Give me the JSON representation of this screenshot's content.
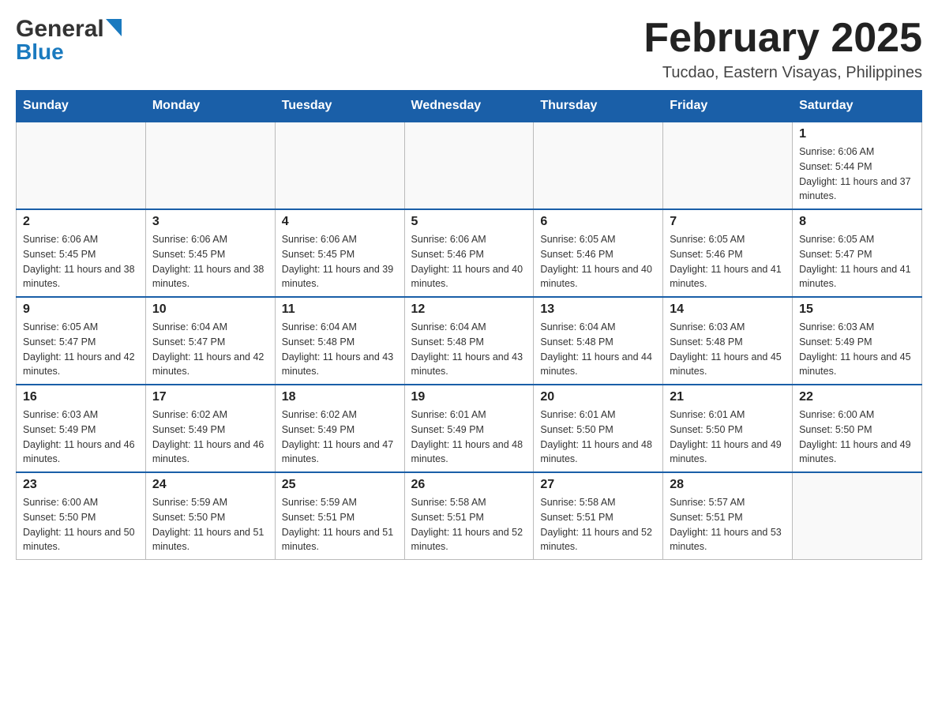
{
  "header": {
    "logo_general": "General",
    "logo_blue": "Blue",
    "month_title": "February 2025",
    "location": "Tucdao, Eastern Visayas, Philippines"
  },
  "weekdays": [
    "Sunday",
    "Monday",
    "Tuesday",
    "Wednesday",
    "Thursday",
    "Friday",
    "Saturday"
  ],
  "weeks": [
    [
      {
        "day": "",
        "sunrise": "",
        "sunset": "",
        "daylight": ""
      },
      {
        "day": "",
        "sunrise": "",
        "sunset": "",
        "daylight": ""
      },
      {
        "day": "",
        "sunrise": "",
        "sunset": "",
        "daylight": ""
      },
      {
        "day": "",
        "sunrise": "",
        "sunset": "",
        "daylight": ""
      },
      {
        "day": "",
        "sunrise": "",
        "sunset": "",
        "daylight": ""
      },
      {
        "day": "",
        "sunrise": "",
        "sunset": "",
        "daylight": ""
      },
      {
        "day": "1",
        "sunrise": "Sunrise: 6:06 AM",
        "sunset": "Sunset: 5:44 PM",
        "daylight": "Daylight: 11 hours and 37 minutes."
      }
    ],
    [
      {
        "day": "2",
        "sunrise": "Sunrise: 6:06 AM",
        "sunset": "Sunset: 5:45 PM",
        "daylight": "Daylight: 11 hours and 38 minutes."
      },
      {
        "day": "3",
        "sunrise": "Sunrise: 6:06 AM",
        "sunset": "Sunset: 5:45 PM",
        "daylight": "Daylight: 11 hours and 38 minutes."
      },
      {
        "day": "4",
        "sunrise": "Sunrise: 6:06 AM",
        "sunset": "Sunset: 5:45 PM",
        "daylight": "Daylight: 11 hours and 39 minutes."
      },
      {
        "day": "5",
        "sunrise": "Sunrise: 6:06 AM",
        "sunset": "Sunset: 5:46 PM",
        "daylight": "Daylight: 11 hours and 40 minutes."
      },
      {
        "day": "6",
        "sunrise": "Sunrise: 6:05 AM",
        "sunset": "Sunset: 5:46 PM",
        "daylight": "Daylight: 11 hours and 40 minutes."
      },
      {
        "day": "7",
        "sunrise": "Sunrise: 6:05 AM",
        "sunset": "Sunset: 5:46 PM",
        "daylight": "Daylight: 11 hours and 41 minutes."
      },
      {
        "day": "8",
        "sunrise": "Sunrise: 6:05 AM",
        "sunset": "Sunset: 5:47 PM",
        "daylight": "Daylight: 11 hours and 41 minutes."
      }
    ],
    [
      {
        "day": "9",
        "sunrise": "Sunrise: 6:05 AM",
        "sunset": "Sunset: 5:47 PM",
        "daylight": "Daylight: 11 hours and 42 minutes."
      },
      {
        "day": "10",
        "sunrise": "Sunrise: 6:04 AM",
        "sunset": "Sunset: 5:47 PM",
        "daylight": "Daylight: 11 hours and 42 minutes."
      },
      {
        "day": "11",
        "sunrise": "Sunrise: 6:04 AM",
        "sunset": "Sunset: 5:48 PM",
        "daylight": "Daylight: 11 hours and 43 minutes."
      },
      {
        "day": "12",
        "sunrise": "Sunrise: 6:04 AM",
        "sunset": "Sunset: 5:48 PM",
        "daylight": "Daylight: 11 hours and 43 minutes."
      },
      {
        "day": "13",
        "sunrise": "Sunrise: 6:04 AM",
        "sunset": "Sunset: 5:48 PM",
        "daylight": "Daylight: 11 hours and 44 minutes."
      },
      {
        "day": "14",
        "sunrise": "Sunrise: 6:03 AM",
        "sunset": "Sunset: 5:48 PM",
        "daylight": "Daylight: 11 hours and 45 minutes."
      },
      {
        "day": "15",
        "sunrise": "Sunrise: 6:03 AM",
        "sunset": "Sunset: 5:49 PM",
        "daylight": "Daylight: 11 hours and 45 minutes."
      }
    ],
    [
      {
        "day": "16",
        "sunrise": "Sunrise: 6:03 AM",
        "sunset": "Sunset: 5:49 PM",
        "daylight": "Daylight: 11 hours and 46 minutes."
      },
      {
        "day": "17",
        "sunrise": "Sunrise: 6:02 AM",
        "sunset": "Sunset: 5:49 PM",
        "daylight": "Daylight: 11 hours and 46 minutes."
      },
      {
        "day": "18",
        "sunrise": "Sunrise: 6:02 AM",
        "sunset": "Sunset: 5:49 PM",
        "daylight": "Daylight: 11 hours and 47 minutes."
      },
      {
        "day": "19",
        "sunrise": "Sunrise: 6:01 AM",
        "sunset": "Sunset: 5:49 PM",
        "daylight": "Daylight: 11 hours and 48 minutes."
      },
      {
        "day": "20",
        "sunrise": "Sunrise: 6:01 AM",
        "sunset": "Sunset: 5:50 PM",
        "daylight": "Daylight: 11 hours and 48 minutes."
      },
      {
        "day": "21",
        "sunrise": "Sunrise: 6:01 AM",
        "sunset": "Sunset: 5:50 PM",
        "daylight": "Daylight: 11 hours and 49 minutes."
      },
      {
        "day": "22",
        "sunrise": "Sunrise: 6:00 AM",
        "sunset": "Sunset: 5:50 PM",
        "daylight": "Daylight: 11 hours and 49 minutes."
      }
    ],
    [
      {
        "day": "23",
        "sunrise": "Sunrise: 6:00 AM",
        "sunset": "Sunset: 5:50 PM",
        "daylight": "Daylight: 11 hours and 50 minutes."
      },
      {
        "day": "24",
        "sunrise": "Sunrise: 5:59 AM",
        "sunset": "Sunset: 5:50 PM",
        "daylight": "Daylight: 11 hours and 51 minutes."
      },
      {
        "day": "25",
        "sunrise": "Sunrise: 5:59 AM",
        "sunset": "Sunset: 5:51 PM",
        "daylight": "Daylight: 11 hours and 51 minutes."
      },
      {
        "day": "26",
        "sunrise": "Sunrise: 5:58 AM",
        "sunset": "Sunset: 5:51 PM",
        "daylight": "Daylight: 11 hours and 52 minutes."
      },
      {
        "day": "27",
        "sunrise": "Sunrise: 5:58 AM",
        "sunset": "Sunset: 5:51 PM",
        "daylight": "Daylight: 11 hours and 52 minutes."
      },
      {
        "day": "28",
        "sunrise": "Sunrise: 5:57 AM",
        "sunset": "Sunset: 5:51 PM",
        "daylight": "Daylight: 11 hours and 53 minutes."
      },
      {
        "day": "",
        "sunrise": "",
        "sunset": "",
        "daylight": ""
      }
    ]
  ]
}
